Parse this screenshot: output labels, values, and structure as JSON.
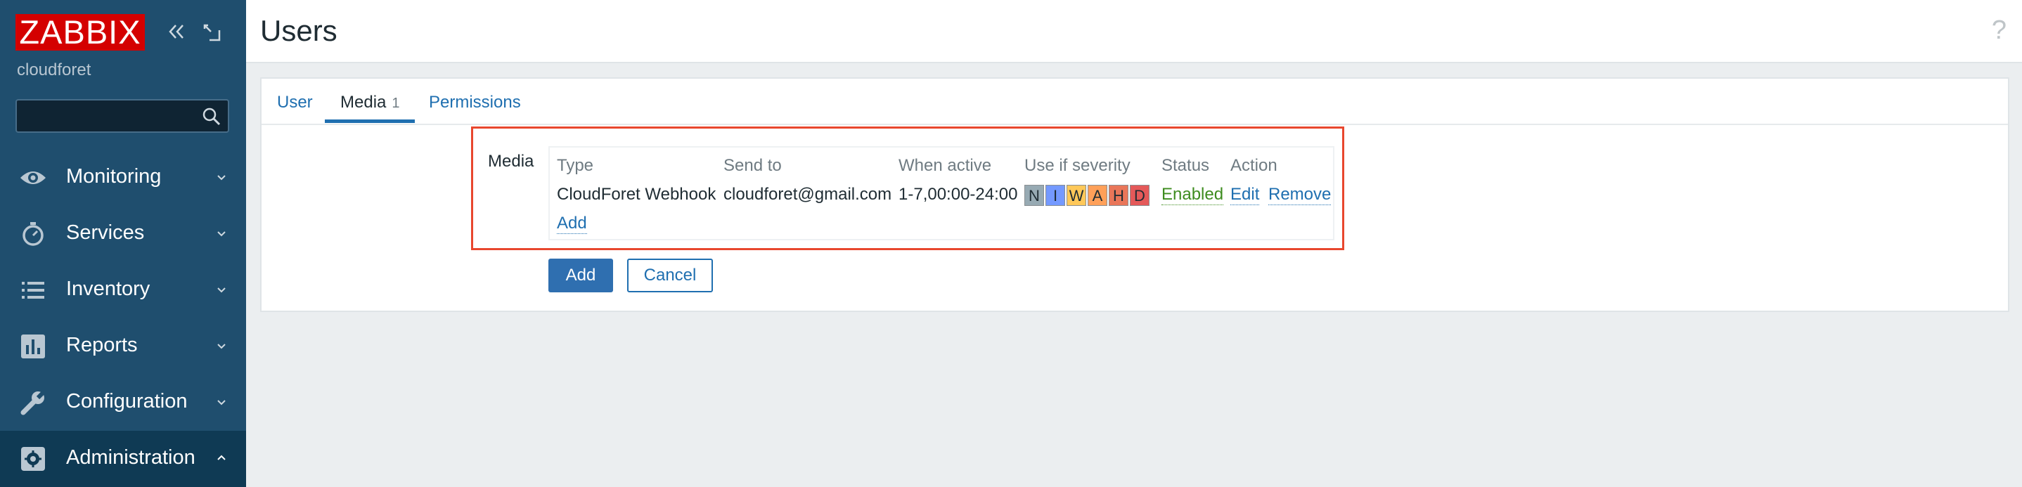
{
  "app": {
    "logo_text": "ZABBIX",
    "server_name": "cloudforet"
  },
  "search": {
    "value": "",
    "placeholder": ""
  },
  "nav": [
    {
      "label": "Monitoring",
      "icon": "eye-icon",
      "expanded": false
    },
    {
      "label": "Services",
      "icon": "stopwatch-icon",
      "expanded": false
    },
    {
      "label": "Inventory",
      "icon": "list-icon",
      "expanded": false
    },
    {
      "label": "Reports",
      "icon": "bar-chart-icon",
      "expanded": false
    },
    {
      "label": "Configuration",
      "icon": "wrench-icon",
      "expanded": false
    },
    {
      "label": "Administration",
      "icon": "gear-icon",
      "expanded": true
    }
  ],
  "header": {
    "title": "Users",
    "help": "?"
  },
  "tabs": [
    {
      "label": "User",
      "active": false
    },
    {
      "label": "Media",
      "active": true,
      "count": "1"
    },
    {
      "label": "Permissions",
      "active": false
    }
  ],
  "media": {
    "label": "Media",
    "columns": [
      "Type",
      "Send to",
      "When active",
      "Use if severity",
      "Status",
      "Action"
    ],
    "rows": [
      {
        "type": "CloudForet Webhook",
        "send_to": "cloudforet@gmail.com",
        "when_active": "1-7,00:00-24:00",
        "severity": [
          "N",
          "I",
          "W",
          "A",
          "H",
          "D"
        ],
        "status": "Enabled",
        "edit": "Edit",
        "remove": "Remove"
      }
    ],
    "add_link": "Add"
  },
  "buttons": {
    "add": "Add",
    "cancel": "Cancel"
  },
  "colors": {
    "sidebar": "#1f4e6e",
    "logo_bg": "#d40000",
    "link": "#1f6fb0",
    "highlight": "#e8472e",
    "status_enabled": "#3e8c1f",
    "severity": [
      "#97aab3",
      "#7499ff",
      "#ffc859",
      "#ffa059",
      "#e97659",
      "#e45959"
    ]
  }
}
